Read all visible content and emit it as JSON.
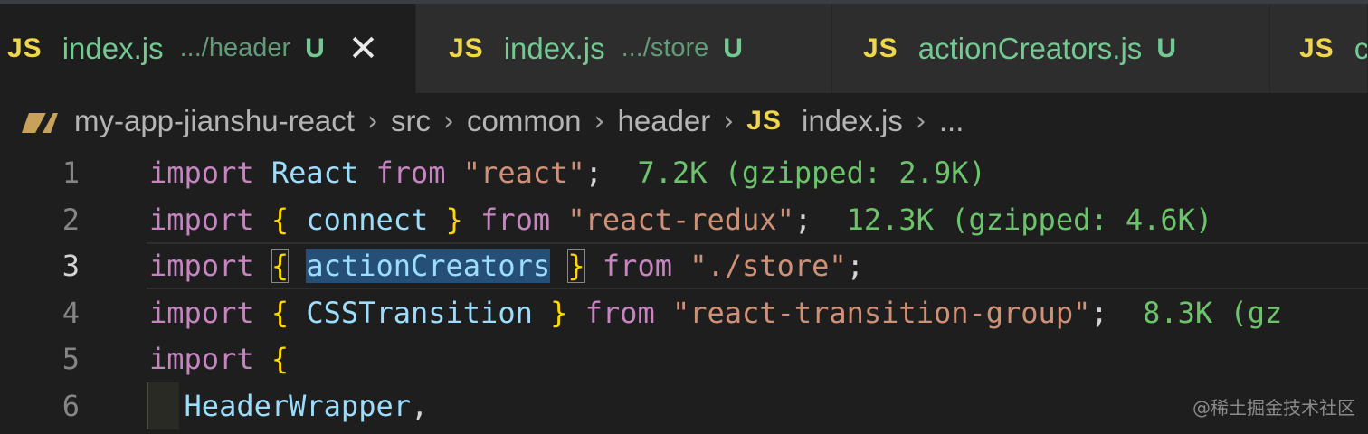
{
  "tabs": [
    {
      "icon": "JS",
      "name": "index.js",
      "path": ".../header",
      "status": "U",
      "close": "✕",
      "active": true
    },
    {
      "icon": "JS",
      "name": "index.js",
      "path": ".../store",
      "status": "U",
      "active": false
    },
    {
      "icon": "JS",
      "name": "actionCreators.js",
      "status": "U",
      "active": false
    },
    {
      "icon": "JS",
      "name": "c",
      "active": false
    }
  ],
  "breadcrumb": {
    "items": [
      "my-app-jianshu-react",
      "src",
      "common",
      "header"
    ],
    "file_icon": "JS",
    "file": "index.js",
    "sep": "›",
    "more": "..."
  },
  "editor": {
    "active_line": 3,
    "lines": [
      {
        "num": "1",
        "parts": [
          [
            "kw",
            "import"
          ],
          [
            "pun",
            " "
          ],
          [
            "id",
            "React"
          ],
          [
            "pun",
            " "
          ],
          [
            "kw",
            "from"
          ],
          [
            "pun",
            " "
          ],
          [
            "str",
            "\"react\""
          ],
          [
            "pun",
            ";"
          ],
          [
            "pun",
            "  "
          ],
          [
            "size",
            "7.2K (gzipped: 2.9K)"
          ]
        ]
      },
      {
        "num": "2",
        "parts": [
          [
            "kw",
            "import"
          ],
          [
            "pun",
            " "
          ],
          [
            "br",
            "{"
          ],
          [
            "pun",
            " "
          ],
          [
            "id",
            "connect"
          ],
          [
            "pun",
            " "
          ],
          [
            "br",
            "}"
          ],
          [
            "pun",
            " "
          ],
          [
            "kw",
            "from"
          ],
          [
            "pun",
            " "
          ],
          [
            "str",
            "\"react-redux\""
          ],
          [
            "pun",
            ";"
          ],
          [
            "pun",
            "  "
          ],
          [
            "size",
            "12.3K (gzipped: 4.6K)"
          ]
        ]
      },
      {
        "num": "3",
        "parts": [
          [
            "kw",
            "import"
          ],
          [
            "pun",
            " "
          ],
          [
            "br brbox",
            "{"
          ],
          [
            "pun",
            " "
          ],
          [
            "id sel",
            "actionCreators"
          ],
          [
            "pun",
            " "
          ],
          [
            "br brbox",
            "}"
          ],
          [
            "pun",
            " "
          ],
          [
            "kw",
            "from"
          ],
          [
            "pun",
            " "
          ],
          [
            "str",
            "\"./store\""
          ],
          [
            "pun",
            ";"
          ]
        ]
      },
      {
        "num": "4",
        "parts": [
          [
            "kw",
            "import"
          ],
          [
            "pun",
            " "
          ],
          [
            "br",
            "{"
          ],
          [
            "pun",
            " "
          ],
          [
            "id",
            "CSSTransition"
          ],
          [
            "pun",
            " "
          ],
          [
            "br",
            "}"
          ],
          [
            "pun",
            " "
          ],
          [
            "kw",
            "from"
          ],
          [
            "pun",
            " "
          ],
          [
            "str",
            "\"react-transition-group\""
          ],
          [
            "pun",
            ";"
          ],
          [
            "pun",
            "  "
          ],
          [
            "size",
            "8.3K (gz"
          ]
        ]
      },
      {
        "num": "5",
        "parts": [
          [
            "kw",
            "import"
          ],
          [
            "pun",
            " "
          ],
          [
            "br",
            "{"
          ]
        ]
      },
      {
        "num": "6",
        "parts": [
          [
            "pun",
            "  "
          ],
          [
            "id",
            "HeaderWrapper"
          ],
          [
            "pun",
            ","
          ]
        ]
      }
    ]
  },
  "watermark": "@稀土掘金技术社区"
}
